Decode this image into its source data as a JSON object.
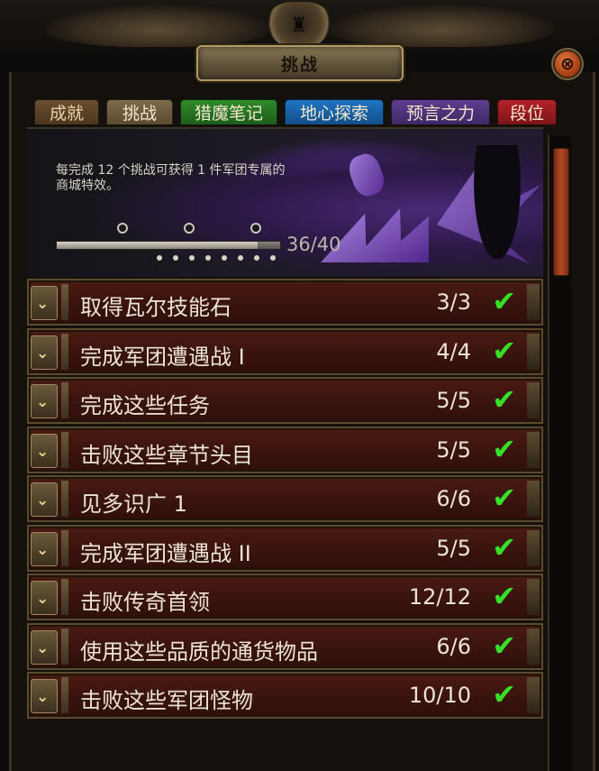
{
  "window": {
    "title": "挑战",
    "close_glyph": "⊗"
  },
  "tabs": [
    {
      "label": "成就"
    },
    {
      "label": "挑战"
    },
    {
      "label": "猎魔笔记"
    },
    {
      "label": "地心探索"
    },
    {
      "label": "预言之力"
    },
    {
      "label": "段位"
    }
  ],
  "banner": {
    "text": "每完成 12 个挑战可获得 1 件军团专属的商城特效。",
    "progress_text": "36/40",
    "completed": 36,
    "total": 40
  },
  "challenges": [
    {
      "name": "取得瓦尔技能石",
      "progress": "3/3"
    },
    {
      "name": "完成军团遭遇战 I",
      "progress": "4/4"
    },
    {
      "name": "完成这些任务",
      "progress": "5/5"
    },
    {
      "name": "击败这些章节头目",
      "progress": "5/5"
    },
    {
      "name": "见多识广 1",
      "progress": "6/6"
    },
    {
      "name": "完成军团遭遇战 II",
      "progress": "5/5"
    },
    {
      "name": "击败传奇首领",
      "progress": "12/12"
    },
    {
      "name": "使用这些品质的通货物品",
      "progress": "6/6"
    },
    {
      "name": "击败这些军团怪物",
      "progress": "10/10"
    }
  ],
  "icons": {
    "expand": "chevron-down-icon",
    "complete": "check-icon",
    "close": "close-icon"
  },
  "colors": {
    "check": "#35e026",
    "row_bg": "#3b140e",
    "tab_hunt": "#2f8a2b",
    "tab_delve": "#1e74c2",
    "tab_prophecy": "#5d3e8f",
    "tab_rank": "#b5222a"
  }
}
